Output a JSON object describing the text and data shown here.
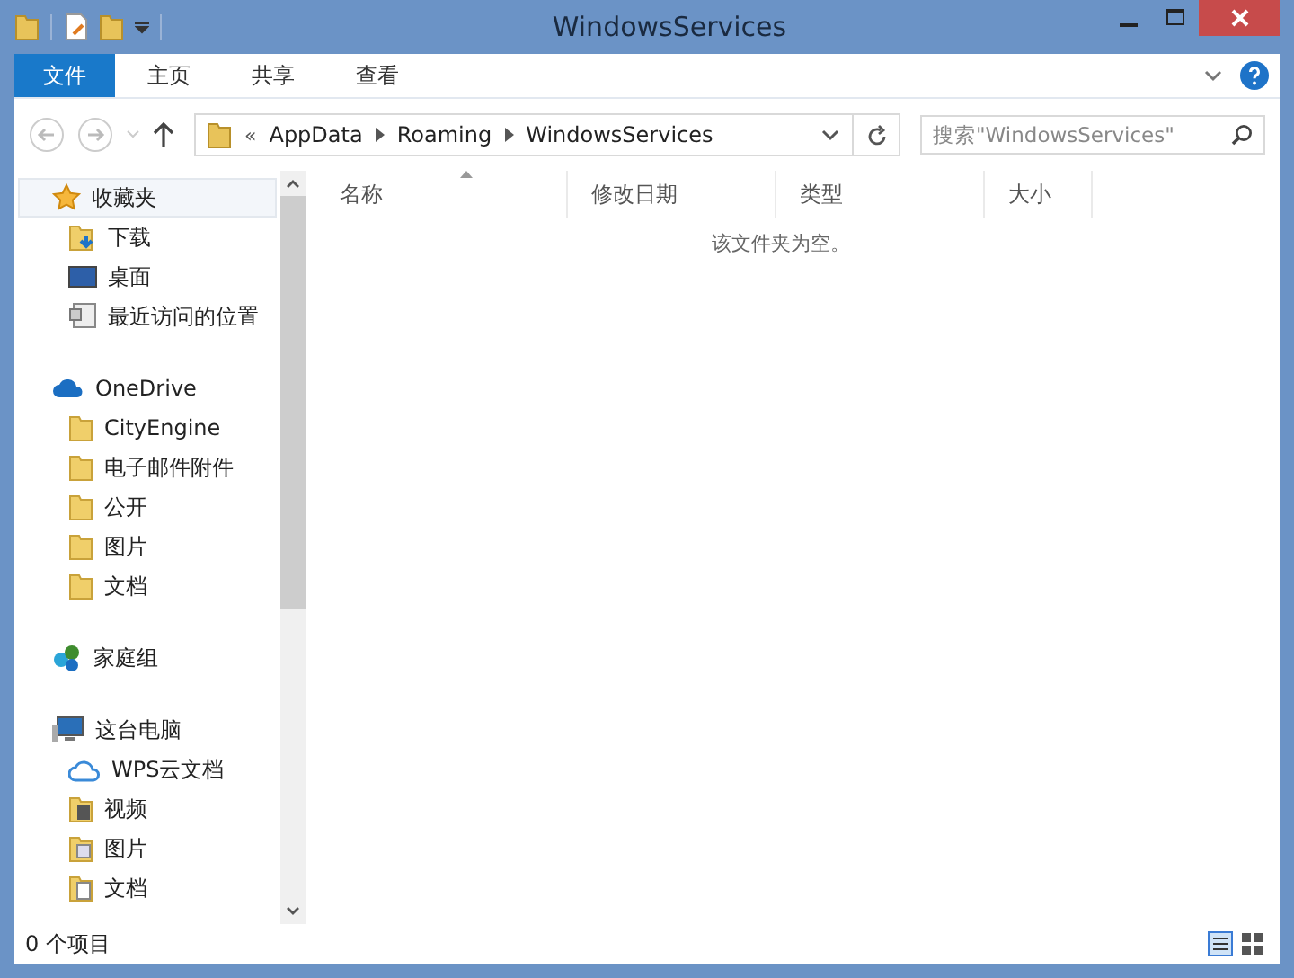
{
  "window": {
    "title": "WindowsServices"
  },
  "ribbon": {
    "tabs": [
      {
        "label": "文件",
        "selected": true
      },
      {
        "label": "主页",
        "selected": false
      },
      {
        "label": "共享",
        "selected": false
      },
      {
        "label": "查看",
        "selected": false
      }
    ]
  },
  "address": {
    "chevron": "«",
    "path": [
      "AppData",
      "Roaming",
      "WindowsServices"
    ]
  },
  "search": {
    "placeholder": "搜索\"WindowsServices\""
  },
  "sidebar": {
    "groups": [
      {
        "label": "收藏夹",
        "kind": "star",
        "selected": true,
        "children": [
          {
            "label": "下载",
            "kind": "download"
          },
          {
            "label": "桌面",
            "kind": "desktop"
          },
          {
            "label": "最近访问的位置",
            "kind": "recent"
          }
        ]
      },
      {
        "label": "OneDrive",
        "kind": "cloud",
        "selected": false,
        "children": [
          {
            "label": "CityEngine",
            "kind": "folder"
          },
          {
            "label": "电子邮件附件",
            "kind": "folder"
          },
          {
            "label": "公开",
            "kind": "folder"
          },
          {
            "label": "图片",
            "kind": "folder"
          },
          {
            "label": "文档",
            "kind": "folder"
          }
        ]
      },
      {
        "label": "家庭组",
        "kind": "homegroup",
        "selected": false
      },
      {
        "label": "这台电脑",
        "kind": "computer",
        "selected": false,
        "children": [
          {
            "label": "WPS云文档",
            "kind": "cloud-outline"
          },
          {
            "label": "视频",
            "kind": "video"
          },
          {
            "label": "图片",
            "kind": "pictures"
          },
          {
            "label": "文档",
            "kind": "docs"
          }
        ]
      }
    ]
  },
  "table": {
    "columns": [
      "名称",
      "修改日期",
      "类型",
      "大小"
    ],
    "empty_message": "该文件夹为空。"
  },
  "status_bar": {
    "count": "0 个项目"
  }
}
